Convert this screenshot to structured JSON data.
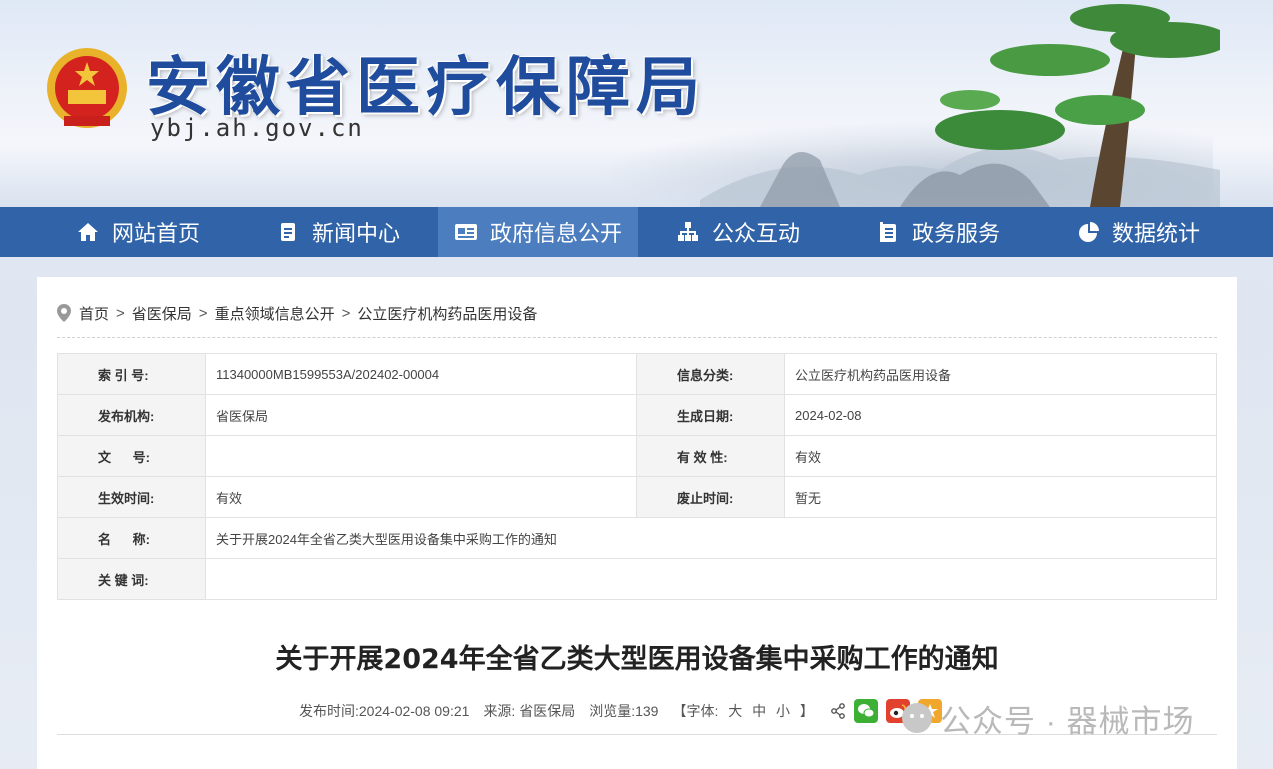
{
  "header": {
    "title": "安徽省医疗保障局",
    "domain": "ybj.ah.gov.cn"
  },
  "nav": {
    "items": [
      {
        "label": "网站首页",
        "icon": "home-icon"
      },
      {
        "label": "新闻中心",
        "icon": "document-icon"
      },
      {
        "label": "政府信息公开",
        "icon": "card-icon",
        "active": true
      },
      {
        "label": "公众互动",
        "icon": "org-chart-icon"
      },
      {
        "label": "政务服务",
        "icon": "clipboard-icon"
      },
      {
        "label": "数据统计",
        "icon": "pie-chart-icon"
      }
    ]
  },
  "breadcrumb": [
    "首页",
    "省医保局",
    "重点领域信息公开",
    "公立医疗机构药品医用设备"
  ],
  "meta": {
    "index_label": "索 引 号:",
    "index_value": "11340000MB1599553A/202402-00004",
    "category_label": "信息分类:",
    "category_value": "公立医疗机构药品医用设备",
    "publisher_label": "发布机构:",
    "publisher_value": "省医保局",
    "gen_date_label": "生成日期:",
    "gen_date_value": "2024-02-08",
    "docno_label": "文      号:",
    "docno_value": "",
    "validity_label": "有 效 性:",
    "validity_value": "有效",
    "effective_label": "生效时间:",
    "effective_value": "有效",
    "repeal_label": "废止时间:",
    "repeal_value": "暂无",
    "name_label": "名      称:",
    "name_value": "关于开展2024年全省乙类大型医用设备集中采购工作的通知",
    "keywords_label": "关 键 词:",
    "keywords_value": ""
  },
  "doc": {
    "title": "关于开展2024年全省乙类大型医用设备集中采购工作的通知",
    "publish_time": "发布时间:2024-02-08 09:21",
    "source": "来源: 省医保局",
    "views": "浏览量:139",
    "font_open": "【字体:",
    "font_large": "大",
    "font_medium": "中",
    "font_small": "小",
    "font_close": "】"
  },
  "watermark": "公众号 · 器械市场",
  "colors": {
    "nav_bg": "#3063a8",
    "nav_active": "#4b7dbf",
    "title_blue": "#1f4c9d"
  }
}
